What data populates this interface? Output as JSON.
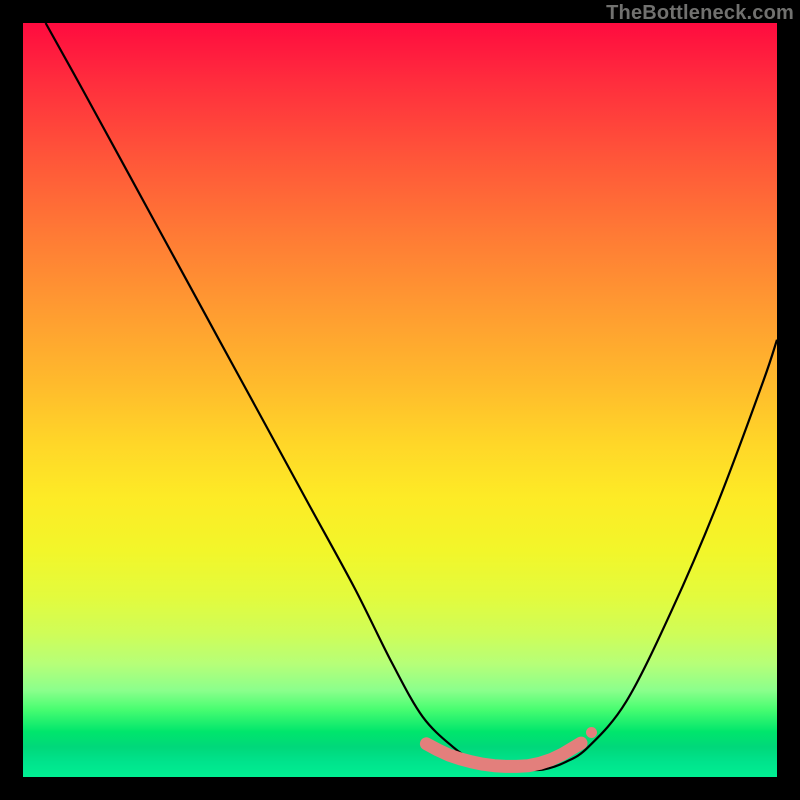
{
  "watermark": "TheBottleneck.com",
  "colors": {
    "curve_stroke": "#000000",
    "marker_fill": "#e37f7c",
    "marker_stroke": "#e37f7c"
  },
  "chart_data": {
    "type": "line",
    "title": "",
    "xlabel": "",
    "ylabel": "",
    "xlim": [
      0,
      100
    ],
    "ylim": [
      0,
      100
    ],
    "series": [
      {
        "name": "bottleneck-curve",
        "x": [
          3,
          8,
          14,
          20,
          26,
          32,
          38,
          44,
          49,
          53,
          57,
          60,
          63,
          66,
          69,
          72,
          75,
          80,
          86,
          92,
          98,
          100
        ],
        "y": [
          100,
          91,
          80,
          69,
          58,
          47,
          36,
          25,
          15,
          8,
          4,
          2,
          1,
          1,
          1,
          2,
          4,
          10,
          22,
          36,
          52,
          58
        ]
      }
    ],
    "markers": [
      {
        "x": 53.5,
        "y": 4.4
      },
      {
        "x": 55.0,
        "y": 3.6
      },
      {
        "x": 56.5,
        "y": 2.9
      },
      {
        "x": 58.0,
        "y": 2.4
      },
      {
        "x": 59.5,
        "y": 2.0
      },
      {
        "x": 61.0,
        "y": 1.7
      },
      {
        "x": 62.5,
        "y": 1.5
      },
      {
        "x": 64.0,
        "y": 1.4
      },
      {
        "x": 65.5,
        "y": 1.4
      },
      {
        "x": 67.0,
        "y": 1.5
      },
      {
        "x": 68.5,
        "y": 1.8
      },
      {
        "x": 70.0,
        "y": 2.3
      },
      {
        "x": 71.5,
        "y": 3.0
      },
      {
        "x": 74.0,
        "y": 4.5
      }
    ]
  }
}
